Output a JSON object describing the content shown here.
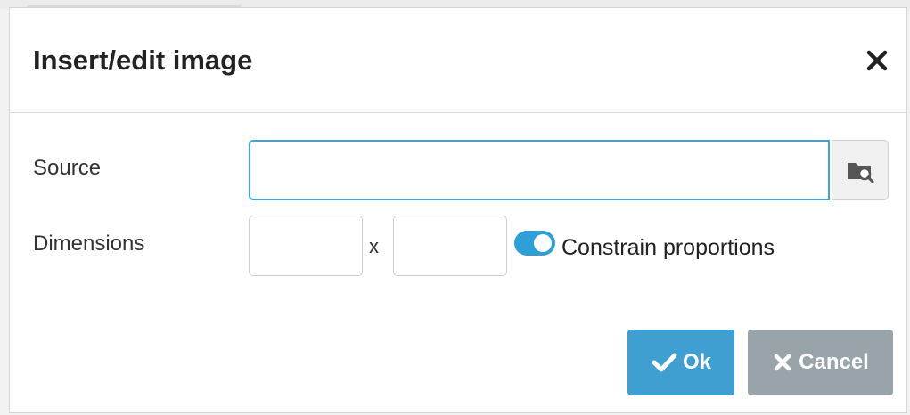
{
  "dialog": {
    "title": "Insert/edit image"
  },
  "form": {
    "source": {
      "label": "Source",
      "value": "",
      "placeholder": ""
    },
    "dimensions": {
      "label": "Dimensions",
      "width_value": "",
      "height_value": "",
      "separator": "x"
    },
    "constrain": {
      "label": "Constrain proportions",
      "enabled": true
    }
  },
  "actions": {
    "ok_label": "Ok",
    "cancel_label": "Cancel"
  },
  "icons": {
    "close": "close-icon",
    "browse": "folder-search-icon",
    "ok": "check-icon",
    "cancel": "x-icon"
  },
  "colors": {
    "accent": "#3f9fd1",
    "input_focus": "#3aa6d9",
    "cancel_bg": "#98a3aa"
  }
}
